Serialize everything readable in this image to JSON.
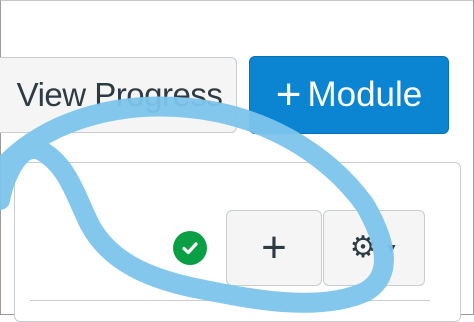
{
  "toolbar": {
    "view_progress_label": "View Progress",
    "add_module_plus": "+",
    "add_module_label": "Module"
  },
  "module": {
    "add_item_label": "+",
    "status": "published"
  },
  "colors": {
    "primary": "#0b84d1",
    "success": "#0b9f45",
    "annotation": "#7cc4ec"
  },
  "icons": {
    "published": "check-circle-icon",
    "settings": "gear-icon",
    "dropdown": "caret-down-icon"
  }
}
